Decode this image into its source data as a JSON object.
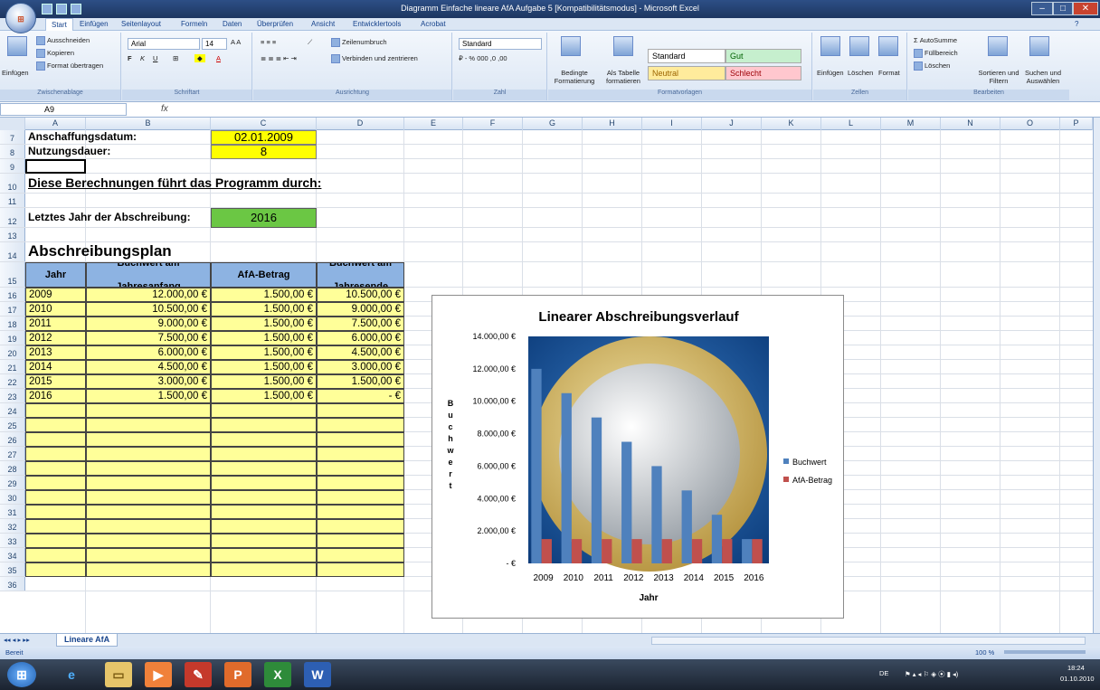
{
  "window": {
    "title": "Diagramm Einfache lineare AfA Aufgabe 5 [Kompatibilitätsmodus] - Microsoft Excel"
  },
  "tabs": [
    "Start",
    "Einfügen",
    "Seitenlayout",
    "Formeln",
    "Daten",
    "Überprüfen",
    "Ansicht",
    "Entwicklertools",
    "Acrobat"
  ],
  "ribbon": {
    "clipboard": {
      "paste": "Einfügen",
      "cut": "Ausschneiden",
      "copy": "Kopieren",
      "format_painter": "Format übertragen",
      "label": "Zwischenablage"
    },
    "font": {
      "name": "Arial",
      "size": "14",
      "label": "Schriftart"
    },
    "alignment": {
      "wrap": "Zeilenumbruch",
      "merge": "Verbinden und zentrieren",
      "label": "Ausrichtung"
    },
    "number": {
      "format": "Standard",
      "label": "Zahl"
    },
    "styles": {
      "conditional": "Bedingte Formatierung",
      "as_table": "Als Tabelle formatieren",
      "standard": "Standard",
      "good": "Gut",
      "neutral": "Neutral",
      "bad": "Schlecht",
      "label": "Formatvorlagen"
    },
    "cells": {
      "insert": "Einfügen",
      "delete": "Löschen",
      "format": "Format",
      "label": "Zellen"
    },
    "editing": {
      "autosum": "AutoSumme",
      "fill": "Füllbereich",
      "clear": "Löschen",
      "sort": "Sortieren und Filtern",
      "find": "Suchen und Auswählen",
      "label": "Bearbeiten"
    }
  },
  "formula_bar": {
    "name_box": "A9",
    "fx": "fx"
  },
  "columns": [
    "A",
    "B",
    "C",
    "D",
    "E",
    "F",
    "G",
    "H",
    "I",
    "J",
    "K",
    "L",
    "M",
    "N",
    "O",
    "P"
  ],
  "rows": [
    "7",
    "8",
    "9",
    "10",
    "11",
    "12",
    "13",
    "14",
    "15",
    "16",
    "17",
    "18",
    "19",
    "20",
    "21",
    "22",
    "23",
    "24",
    "25",
    "26",
    "27",
    "28",
    "29",
    "30",
    "31",
    "32",
    "33",
    "34",
    "35",
    "36"
  ],
  "sheet": {
    "acq_label": "Anschaffungsdatum:",
    "acq_value": "02.01.2009",
    "dur_label": "Nutzungsdauer:",
    "dur_value": "8",
    "calc_heading": "Diese Berechnungen führt das Programm durch:",
    "last_label": "Letztes Jahr der Abschreibung:",
    "last_value": "2016",
    "plan_heading": "Abschreibungsplan",
    "table_headers": [
      "Jahr",
      "Buchwert am Jahresanfang",
      "AfA-Betrag",
      "Buchwert am Jahresende"
    ],
    "table_rows": [
      [
        "2009",
        "12.000,00 €",
        "1.500,00 €",
        "10.500,00 €"
      ],
      [
        "2010",
        "10.500,00 €",
        "1.500,00 €",
        "9.000,00 €"
      ],
      [
        "2011",
        "9.000,00 €",
        "1.500,00 €",
        "7.500,00 €"
      ],
      [
        "2012",
        "7.500,00 €",
        "1.500,00 €",
        "6.000,00 €"
      ],
      [
        "2013",
        "6.000,00 €",
        "1.500,00 €",
        "4.500,00 €"
      ],
      [
        "2014",
        "4.500,00 €",
        "1.500,00 €",
        "3.000,00 €"
      ],
      [
        "2015",
        "3.000,00 €",
        "1.500,00 €",
        "1.500,00 €"
      ],
      [
        "2016",
        "1.500,00 €",
        "1.500,00 €",
        "-   €"
      ]
    ]
  },
  "chart_data": {
    "type": "bar",
    "title": "Linearer Abschreibungsverlauf",
    "xlabel": "Jahr",
    "ylabel": "Buchwert",
    "categories": [
      "2009",
      "2010",
      "2011",
      "2012",
      "2013",
      "2014",
      "2015",
      "2016"
    ],
    "series": [
      {
        "name": "Buchwert",
        "values": [
          12000,
          10500,
          9000,
          7500,
          6000,
          4500,
          3000,
          1500
        ],
        "color": "#4f81bd"
      },
      {
        "name": "AfA-Betrag",
        "values": [
          1500,
          1500,
          1500,
          1500,
          1500,
          1500,
          1500,
          1500
        ],
        "color": "#c0504d"
      }
    ],
    "ylim": [
      0,
      14000
    ],
    "yticks": [
      "-   €",
      "2.000,00 €",
      "4.000,00 €",
      "6.000,00 €",
      "8.000,00 €",
      "10.000,00 €",
      "12.000,00 €",
      "14.000,00 €"
    ],
    "legend": "right"
  },
  "sheet_tab": "Lineare AfA",
  "status": {
    "ready": "Bereit",
    "zoom": "100 %"
  },
  "taskbar": {
    "lang": "DE",
    "time": "18:24",
    "date": "01.10.2010"
  }
}
